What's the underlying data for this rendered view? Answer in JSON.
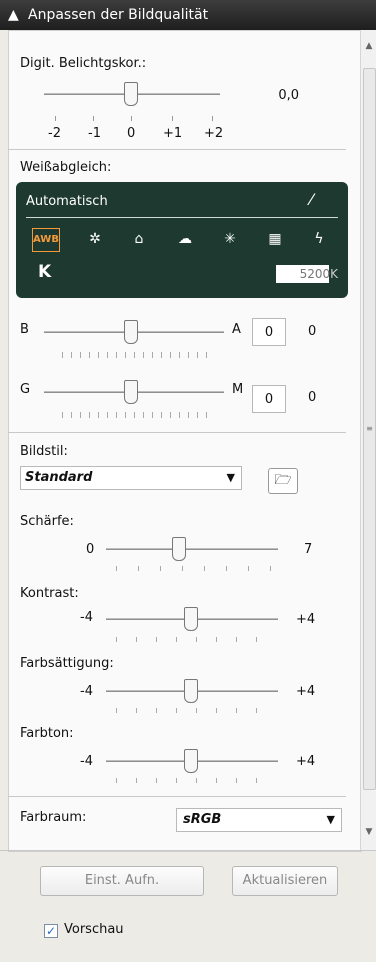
{
  "title": "Anpassen der Bildqualität",
  "exposure": {
    "label": "Digit. Belichtgskor.:",
    "value": "0,0",
    "ticks": [
      "-2",
      "-1",
      "0",
      "+1",
      "+2"
    ]
  },
  "white_balance": {
    "label": "Weißabgleich:",
    "mode": "Automatisch",
    "awb_label": "AWB",
    "k_label": "K",
    "kelvin": "5200",
    "kelvin_unit": "K",
    "icons": [
      "daylight-icon",
      "shade-icon",
      "cloudy-icon",
      "tungsten-icon",
      "fluorescent-icon",
      "flash-icon"
    ]
  },
  "shift": {
    "b_label": "B",
    "a_label": "A",
    "ba_value": "0",
    "ba_text": "0",
    "g_label": "G",
    "m_label": "M",
    "gm_value": "0",
    "gm_text": "0"
  },
  "picture_style": {
    "label": "Bildstil:",
    "selected": "Standard"
  },
  "sharpness": {
    "label": "Schärfe:",
    "min": "0",
    "max": "7"
  },
  "contrast": {
    "label": "Kontrast:",
    "min": "-4",
    "max": "+4"
  },
  "saturation": {
    "label": "Farbsättigung:",
    "min": "-4",
    "max": "+4"
  },
  "tone": {
    "label": "Farbton:",
    "min": "-4",
    "max": "+4"
  },
  "colorspace": {
    "label": "Farbraum:",
    "selected": "sRGB"
  },
  "buttons": {
    "shot_settings": "Einst. Aufn.",
    "refresh": "Aktualisieren"
  },
  "preview": {
    "label": "Vorschau",
    "checked": true
  },
  "colors": {
    "titlebar": "#2b2b2b",
    "wb_panel": "#1e3a30",
    "awb_accent": "#f39b3b"
  }
}
